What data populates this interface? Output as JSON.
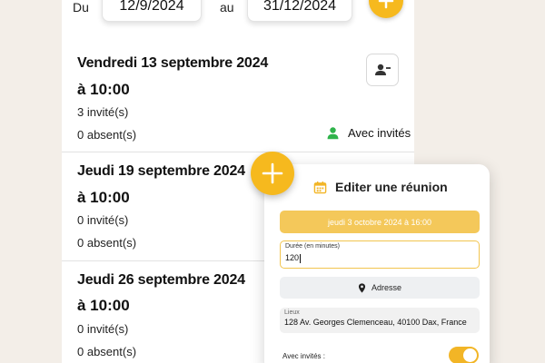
{
  "filters": {
    "from_label": "Du",
    "from_date": "12/9/2024",
    "to_label": "au",
    "to_date": "31/12/2024",
    "add_icon": "plus-icon"
  },
  "meetings": [
    {
      "title": "Vendredi 13 septembre 2024",
      "time": "à 10:00",
      "invited": "3 invité(s)",
      "absent": "0 absent(s)",
      "action_icon": "remove-person-icon",
      "with_guests": "Avec invités"
    },
    {
      "title": "Jeudi 19 septembre 2024",
      "time": "à 10:00",
      "invited": "0 invité(s)",
      "absent": "0 absent(s)"
    },
    {
      "title": "Jeudi 26 septembre 2024",
      "time": "à 10:00",
      "invited": "0 invité(s)",
      "absent": "0 absent(s)"
    }
  ],
  "dialog": {
    "icon": "calendar-icon",
    "title": "Editer une réunion",
    "date_button": "jeudi 3 octobre 2024 à 16:00",
    "duration_label": "Durée (en minutes)",
    "duration_value": "120",
    "address_button": "Adresse",
    "address_icon": "location-pin-icon",
    "place_label": "Lieux",
    "place_value": "128 Av. Georges Clemenceau, 40100 Dax, France",
    "with_guests_label": "Avec invités :",
    "with_guests_on": true
  },
  "colors": {
    "accent": "#f6b91e",
    "accent_light": "#f4c85a",
    "success": "#2fb34b",
    "background": "#f3eee8"
  }
}
